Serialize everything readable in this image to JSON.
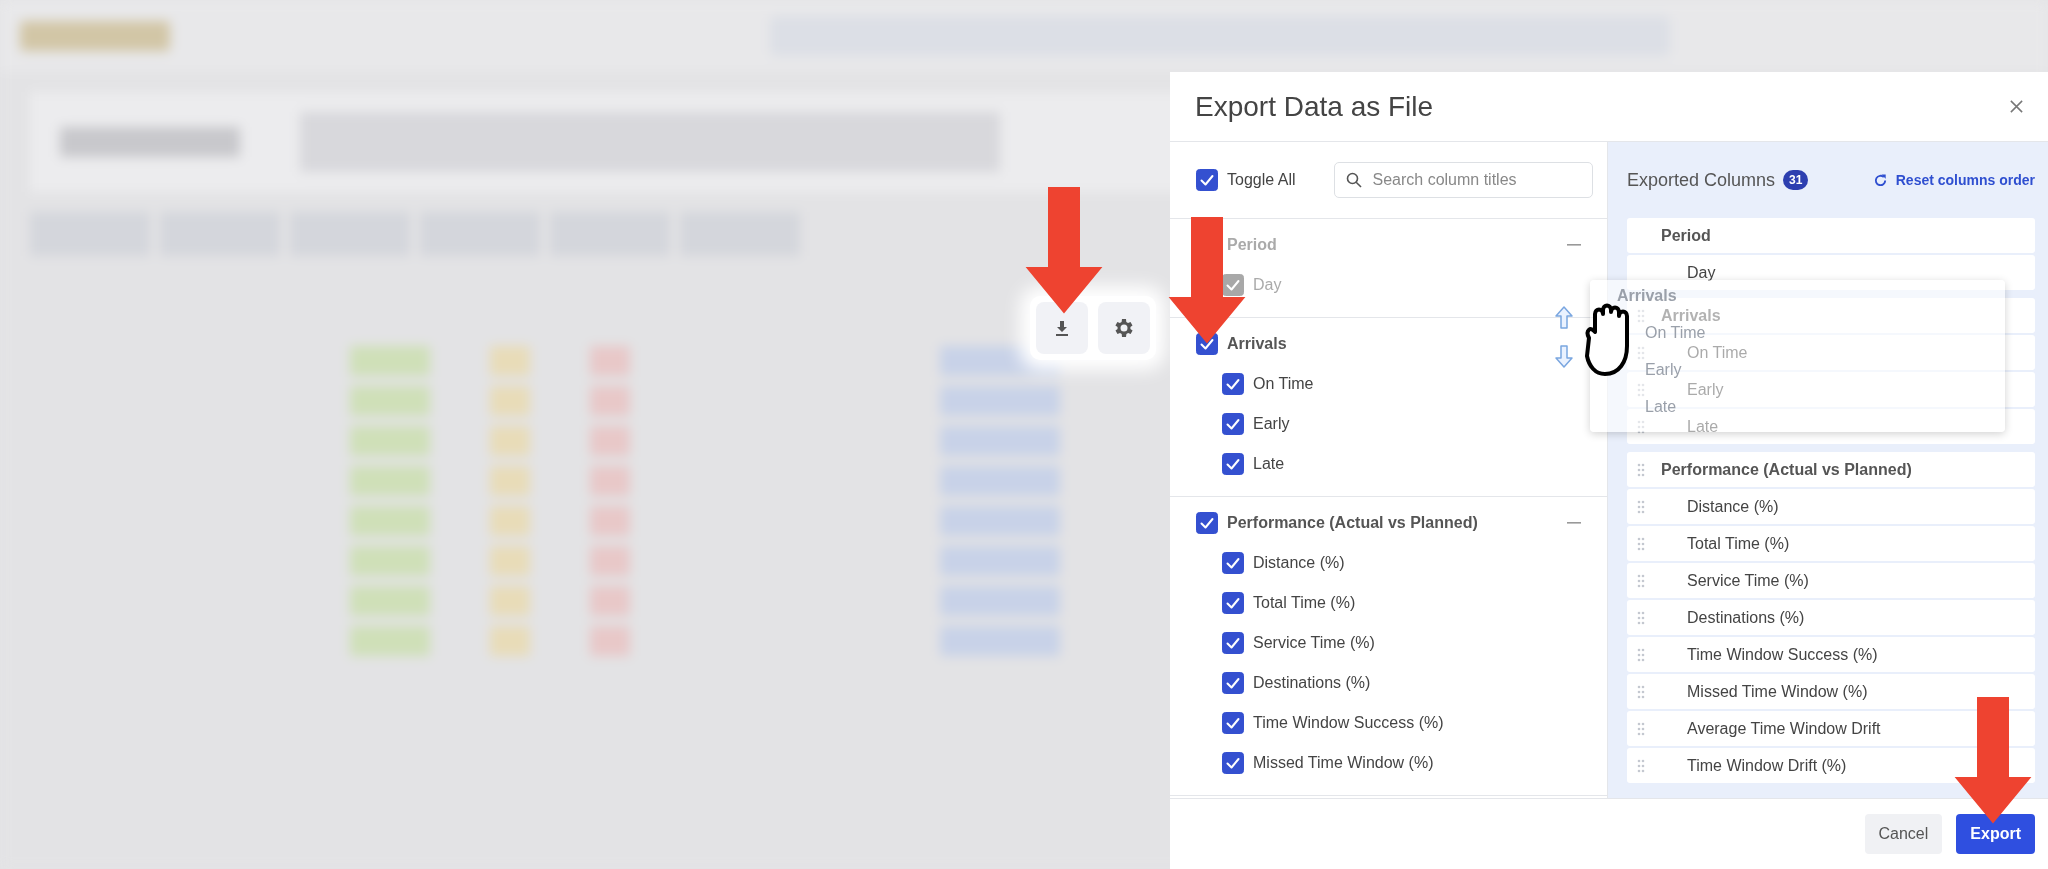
{
  "dialog": {
    "title": "Export Data as File"
  },
  "toggle_all": {
    "label": "Toggle All",
    "checked": true
  },
  "search": {
    "placeholder": "Search column titles"
  },
  "groups": [
    {
      "title": "Period",
      "disabled": true,
      "collapse_button": true,
      "items": [
        {
          "label": "Day",
          "checked": true
        }
      ]
    },
    {
      "title": "Arrivals",
      "checked": true,
      "disabled": false,
      "items": [
        {
          "label": "On Time",
          "checked": true
        },
        {
          "label": "Early",
          "checked": true
        },
        {
          "label": "Late",
          "checked": true
        }
      ]
    },
    {
      "title": "Performance (Actual vs Planned)",
      "checked": true,
      "disabled": false,
      "collapse_button": true,
      "items": [
        {
          "label": "Distance (%)",
          "checked": true
        },
        {
          "label": "Total Time (%)",
          "checked": true
        },
        {
          "label": "Service Time (%)",
          "checked": true
        },
        {
          "label": "Destinations (%)",
          "checked": true
        },
        {
          "label": "Time Window Success (%)",
          "checked": true
        },
        {
          "label": "Missed Time Window (%)",
          "checked": true
        }
      ]
    }
  ],
  "exported": {
    "title": "Exported Columns",
    "count": "31",
    "reset_label": "Reset columns order",
    "groups": [
      {
        "title": "Period",
        "draggable": false,
        "items": [
          {
            "label": "Day",
            "draggable": false
          }
        ]
      },
      {
        "title": "Arrivals",
        "draggable": true,
        "items": [
          {
            "label": "On Time",
            "draggable": true
          },
          {
            "label": "Early",
            "draggable": true
          },
          {
            "label": "Late",
            "draggable": true
          }
        ]
      },
      {
        "title": "Performance (Actual vs Planned)",
        "draggable": true,
        "items": [
          {
            "label": "Distance (%)",
            "draggable": true
          },
          {
            "label": "Total Time (%)",
            "draggable": true
          },
          {
            "label": "Service Time (%)",
            "draggable": true
          },
          {
            "label": "Destinations (%)",
            "draggable": true
          },
          {
            "label": "Time Window Success (%)",
            "draggable": true
          },
          {
            "label": "Missed Time Window (%)",
            "draggable": true
          },
          {
            "label": "Average Time Window Drift",
            "draggable": true
          },
          {
            "label": "Time Window Drift (%)",
            "draggable": true
          }
        ]
      }
    ]
  },
  "drag_ghost": {
    "title": "Arrivals",
    "items": [
      "On Time",
      "Early",
      "Late"
    ]
  },
  "buttons": [
    {
      "label": "Cancel",
      "kind": "secondary"
    },
    {
      "label": "Export",
      "kind": "primary"
    }
  ]
}
